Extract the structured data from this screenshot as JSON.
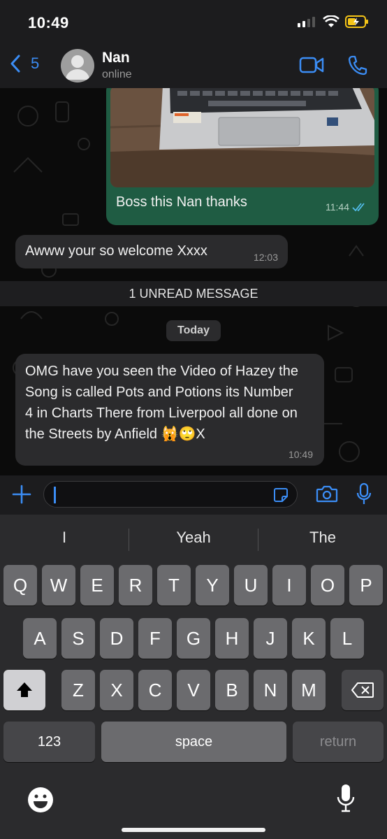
{
  "status_bar": {
    "time": "10:49"
  },
  "header": {
    "back_count": "5",
    "contact_name": "Nan",
    "contact_status": "online"
  },
  "messages": [
    {
      "direction": "outgoing",
      "type": "image",
      "text": "Boss this Nan thanks",
      "time": "11:44",
      "read": true
    },
    {
      "direction": "incoming",
      "text": "Awww your so welcome Xxxx",
      "time": "12:03"
    },
    {
      "direction": "incoming",
      "text": "OMG have you seen the Video of Hazey the Song is  called Pots and Potions its Number  4 in Charts There from Liverpool all done on the Streets by Anfield 🙀🙄X",
      "time": "10:49"
    }
  ],
  "unread_banner": "1 UNREAD MESSAGE",
  "date_separator": "Today",
  "composer": {
    "placeholder": ""
  },
  "keyboard": {
    "suggestions": [
      "I",
      "Yeah",
      "The"
    ],
    "row1": [
      "Q",
      "W",
      "E",
      "R",
      "T",
      "Y",
      "U",
      "I",
      "O",
      "P"
    ],
    "row2": [
      "A",
      "S",
      "D",
      "F",
      "G",
      "H",
      "J",
      "K",
      "L"
    ],
    "row3": [
      "Z",
      "X",
      "C",
      "V",
      "B",
      "N",
      "M"
    ],
    "numbers_key": "123",
    "space_key": "space",
    "return_key": "return"
  },
  "colors": {
    "accent": "#3b8df5",
    "outgoing_bubble": "#1f5c43",
    "incoming_bubble": "#2b2b2d"
  }
}
